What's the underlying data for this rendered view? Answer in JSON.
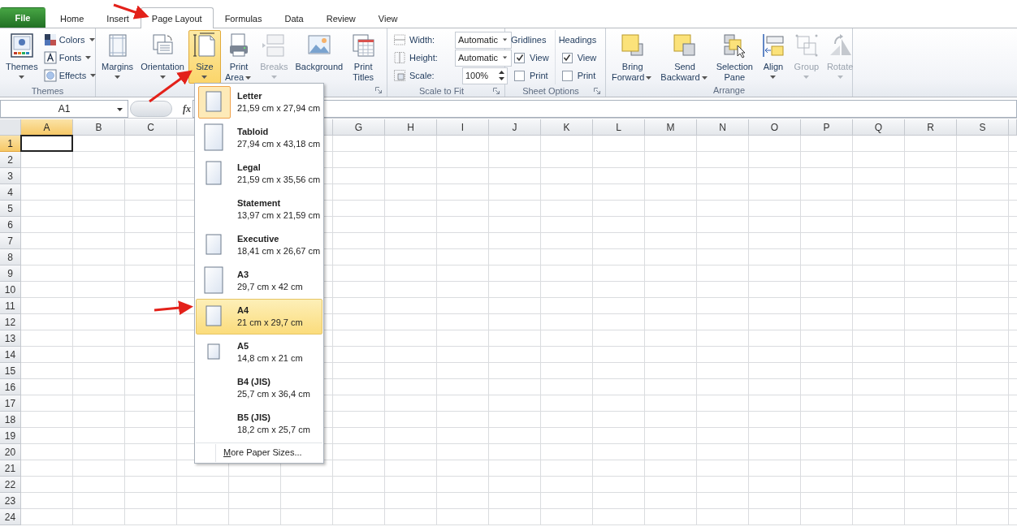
{
  "tabs": [
    {
      "label": "File",
      "kind": "file",
      "selected": false
    },
    {
      "label": "Home",
      "kind": "tab",
      "selected": false
    },
    {
      "label": "Insert",
      "kind": "tab",
      "selected": false
    },
    {
      "label": "Page Layout",
      "kind": "tab",
      "selected": true
    },
    {
      "label": "Formulas",
      "kind": "tab",
      "selected": false
    },
    {
      "label": "Data",
      "kind": "tab",
      "selected": false
    },
    {
      "label": "Review",
      "kind": "tab",
      "selected": false
    },
    {
      "label": "View",
      "kind": "tab",
      "selected": false
    }
  ],
  "ribbon": [
    {
      "kind": "buttons",
      "label": "Themes",
      "large": [
        {
          "label": "Themes",
          "kind": "themes",
          "dropdown": true,
          "caret_beside": false,
          "pressed": false,
          "disabled": false
        }
      ],
      "small": [
        {
          "label": "Colors",
          "kind": "colors"
        },
        {
          "label": "Fonts",
          "kind": "fonts"
        },
        {
          "label": "Effects",
          "kind": "effects"
        }
      ]
    },
    {
      "kind": "buttons",
      "launcher": true,
      "large": [
        {
          "label": "Margins",
          "kind": "margins",
          "dropdown": true,
          "caret_beside": false,
          "pressed": false,
          "disabled": false
        },
        {
          "label": "Orientation",
          "kind": "orientation",
          "dropdown": true,
          "caret_beside": false,
          "pressed": false,
          "disabled": false
        },
        {
          "label": "Size",
          "kind": "size",
          "dropdown": true,
          "caret_beside": false,
          "pressed": true,
          "disabled": false
        },
        {
          "label": "Print\nArea",
          "kind": "print-area",
          "dropdown": true,
          "caret_beside": true,
          "pressed": false,
          "disabled": false
        },
        {
          "label": "Breaks",
          "kind": "breaks",
          "dropdown": true,
          "caret_beside": false,
          "pressed": false,
          "disabled": true
        },
        {
          "label": "Background",
          "kind": "background",
          "dropdown": false,
          "pressed": false,
          "disabled": false
        },
        {
          "label": "Print\nTitles",
          "kind": "print-titles",
          "dropdown": false,
          "pressed": false,
          "disabled": false
        }
      ]
    },
    {
      "kind": "scale",
      "label": "Scale to Fit",
      "launcher": true,
      "rows": [
        {
          "label": "Width:",
          "kind": "select",
          "value": "Automatic"
        },
        {
          "label": "Height:",
          "kind": "select",
          "value": "Automatic"
        },
        {
          "label": "Scale:",
          "kind": "spin",
          "value": "100%"
        }
      ]
    },
    {
      "kind": "sheet",
      "label": "Sheet Options",
      "launcher": true,
      "columns": [
        {
          "heading": "Gridlines",
          "options": [
            {
              "label": "View",
              "checked": true
            },
            {
              "label": "Print",
              "checked": false
            }
          ]
        },
        {
          "heading": "Headings",
          "options": [
            {
              "label": "View",
              "checked": true
            },
            {
              "label": "Print",
              "checked": false
            }
          ]
        }
      ]
    },
    {
      "kind": "buttons",
      "label": "Arrange",
      "large": [
        {
          "label": "Bring\nForward",
          "kind": "bring-forward",
          "dropdown": true,
          "caret_beside": true,
          "pressed": false,
          "disabled": false
        },
        {
          "label": "Send\nBackward",
          "kind": "send-backward",
          "dropdown": true,
          "caret_beside": true,
          "pressed": false,
          "disabled": false
        },
        {
          "label": "Selection\nPane",
          "kind": "selection-pane",
          "dropdown": false,
          "pressed": false,
          "disabled": false
        },
        {
          "label": "Align",
          "kind": "align",
          "dropdown": true,
          "caret_beside": false,
          "pressed": false,
          "disabled": false
        },
        {
          "label": "Group",
          "kind": "group",
          "dropdown": true,
          "caret_beside": false,
          "pressed": false,
          "disabled": true
        },
        {
          "label": "Rotate",
          "kind": "rotate",
          "dropdown": true,
          "caret_beside": false,
          "pressed": false,
          "disabled": true
        }
      ]
    }
  ],
  "formula_bar": {
    "name_box": "A1",
    "function_label": "fx"
  },
  "sheet": {
    "columns": [
      {
        "label": "A",
        "selected": true
      },
      {
        "label": "B",
        "selected": false
      },
      {
        "label": "C",
        "selected": false
      },
      {
        "selected": false
      },
      {},
      {
        "selected": false
      },
      {
        "label": "G",
        "selected": false
      },
      {
        "label": "H",
        "selected": false
      },
      {
        "label": "I",
        "selected": false
      },
      {
        "label": "J",
        "selected": false
      },
      {
        "label": "K",
        "selected": false
      },
      {
        "label": "L",
        "selected": false
      },
      {
        "label": "M",
        "selected": false
      },
      {
        "label": "N",
        "selected": false
      },
      {
        "label": "O",
        "selected": false
      },
      {
        "label": "P",
        "selected": false
      },
      {
        "label": "Q",
        "selected": false
      },
      {
        "label": "R",
        "selected": false
      },
      {
        "label": "S",
        "selected": false
      }
    ],
    "rows": [
      {
        "label": "1",
        "selected": true
      },
      {
        "label": "2",
        "selected": false
      },
      {
        "label": "3",
        "selected": false
      },
      {
        "label": "4",
        "selected": false
      },
      {
        "label": "5",
        "selected": false
      },
      {
        "label": "6",
        "selected": false
      },
      {
        "label": "7",
        "selected": false
      },
      {
        "label": "8",
        "selected": false
      },
      {
        "label": "9",
        "selected": false
      },
      {
        "label": "10",
        "selected": false
      },
      {
        "label": "11",
        "selected": false
      },
      {
        "label": "12",
        "selected": false
      },
      {
        "label": "13",
        "selected": false
      },
      {
        "label": "14",
        "selected": false
      },
      {
        "label": "15",
        "selected": false
      },
      {
        "label": "16",
        "selected": false
      },
      {
        "label": "17",
        "selected": false
      },
      {
        "label": "18",
        "selected": false
      },
      {
        "label": "19",
        "selected": false
      },
      {
        "label": "20",
        "selected": false
      },
      {
        "label": "21",
        "selected": false
      },
      {
        "label": "22",
        "selected": false
      },
      {
        "label": "23",
        "selected": false
      },
      {
        "label": "24",
        "selected": false
      }
    ]
  },
  "size_menu": {
    "items": [
      {
        "name": "Letter",
        "dimensions": "21,59 cm x 27,94 cm",
        "kind": "medium",
        "selected": true,
        "highlighted": false
      },
      {
        "name": "Tabloid",
        "dimensions": "27,94 cm x 43,18 cm",
        "kind": "large",
        "selected": false,
        "highlighted": false
      },
      {
        "name": "Legal",
        "dimensions": "21,59 cm x 35,56 cm",
        "kind": "tall",
        "selected": false,
        "highlighted": false
      },
      {
        "name": "Statement",
        "dimensions": "13,97 cm x 21,59 cm",
        "kind": "none",
        "selected": false,
        "highlighted": false
      },
      {
        "name": "Executive",
        "dimensions": "18,41 cm x 26,67 cm",
        "kind": "medium",
        "selected": false,
        "highlighted": false
      },
      {
        "name": "A3",
        "dimensions": "29,7 cm x 42 cm",
        "kind": "large",
        "selected": false,
        "highlighted": false
      },
      {
        "name": "A4",
        "dimensions": "21 cm x 29,7 cm",
        "kind": "medium",
        "selected": false,
        "highlighted": true
      },
      {
        "name": "A5",
        "dimensions": "14,8 cm x 21 cm",
        "kind": "small",
        "selected": false,
        "highlighted": false
      },
      {
        "name": "B4 (JIS)",
        "dimensions": "25,7 cm x 36,4 cm",
        "kind": "none",
        "selected": false,
        "highlighted": false
      },
      {
        "name": "B5 (JIS)",
        "dimensions": "18,2 cm x 25,7 cm",
        "kind": "none",
        "selected": false,
        "highlighted": false
      }
    ],
    "more": "More Paper Sizes..."
  }
}
